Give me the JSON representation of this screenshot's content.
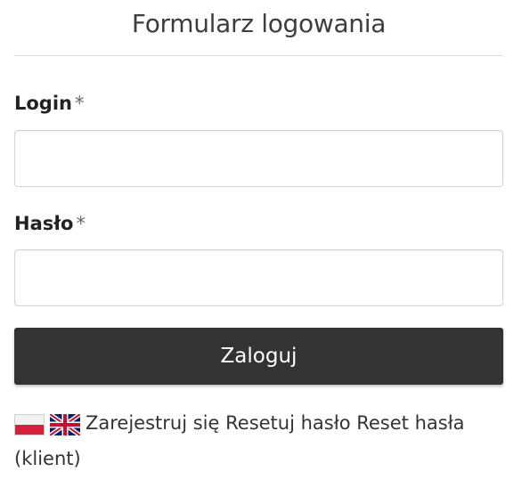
{
  "form": {
    "title": "Formularz logowania",
    "login_label": "Login",
    "password_label": "Hasło",
    "required_marker": "*",
    "login_value": "",
    "password_value": "",
    "submit_label": "Zaloguj"
  },
  "footer": {
    "flags": [
      {
        "icon": "poland-flag-icon"
      },
      {
        "icon": "uk-flag-icon"
      }
    ],
    "register_link": "Zarejestruj się",
    "reset_password_link": "Resetuj hasło",
    "reset_password_client_link": "Reset hasła (klient)"
  },
  "colors": {
    "button_bg": "#333333",
    "button_text": "#ffffff",
    "divider": "#dcdcdc",
    "input_border": "#d3d3d3"
  }
}
